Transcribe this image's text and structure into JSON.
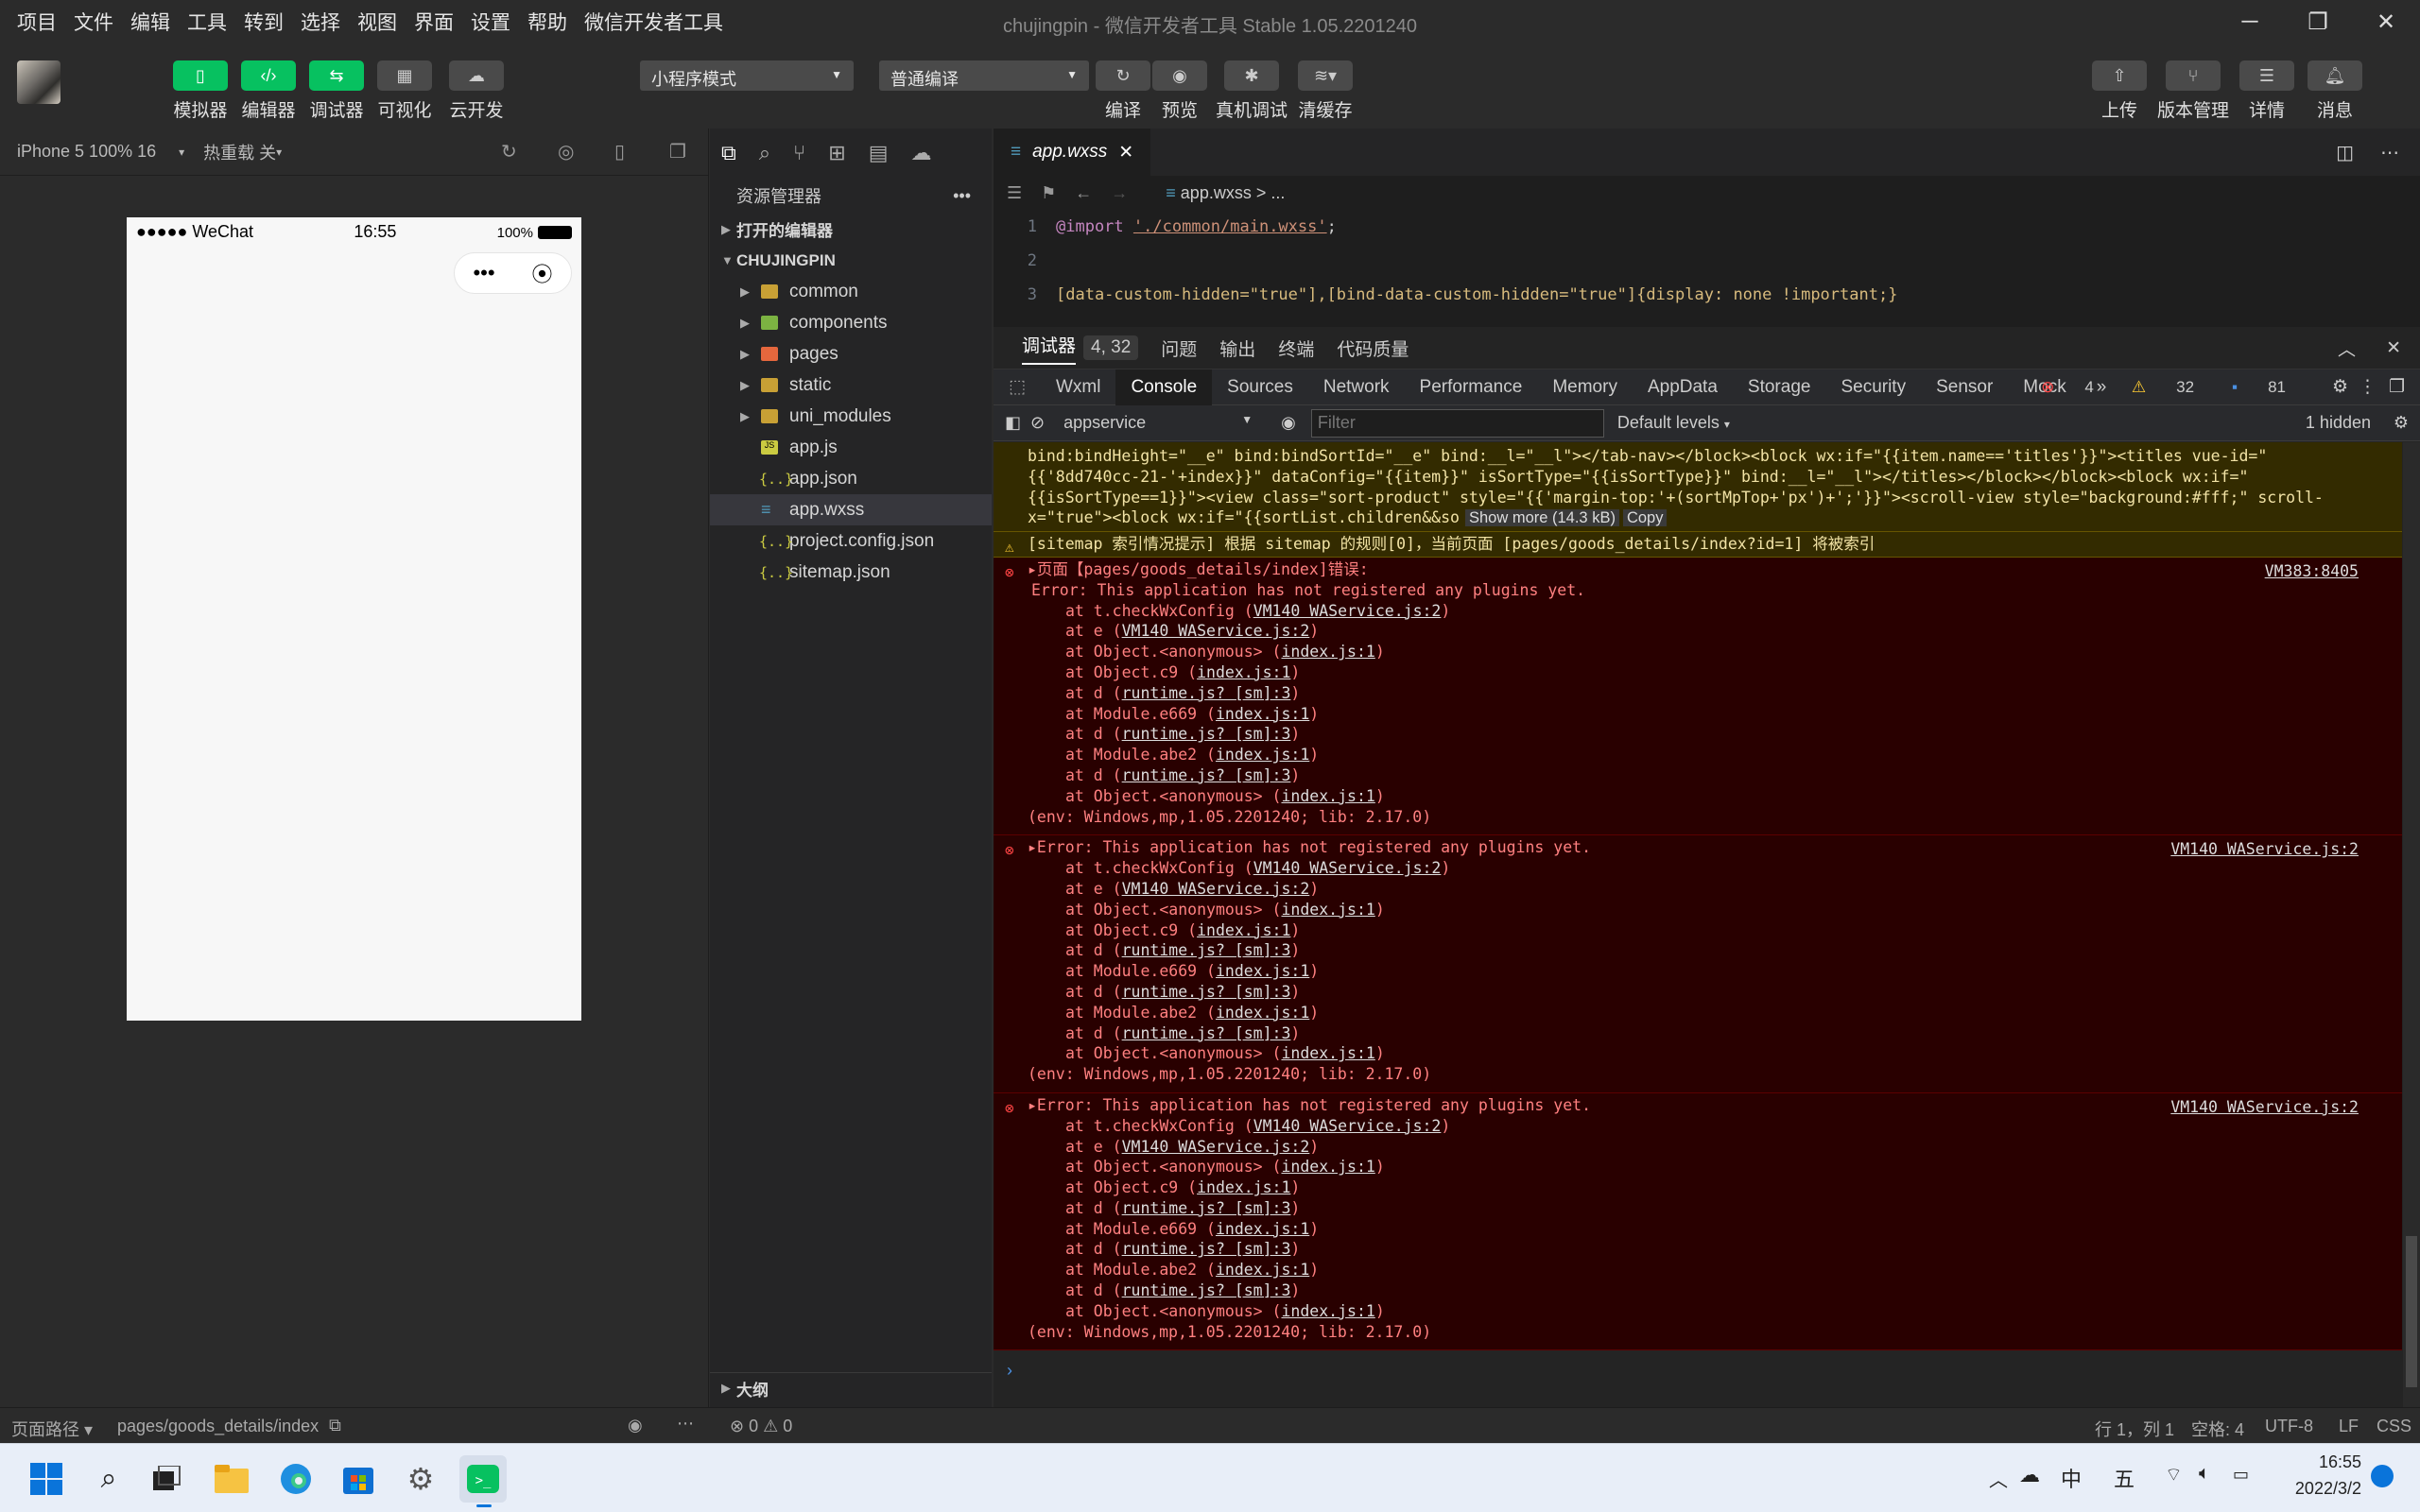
{
  "menu": [
    "项目",
    "文件",
    "编辑",
    "工具",
    "转到",
    "选择",
    "视图",
    "界面",
    "设置",
    "帮助",
    "微信开发者工具"
  ],
  "window_title": "chujingpin - 微信开发者工具 Stable 1.05.2201240",
  "toolbar": {
    "left_buttons": [
      "模拟器",
      "编辑器",
      "调试器",
      "可视化",
      "云开发"
    ],
    "mode_select": "小程序模式",
    "compile_select": "普通编译",
    "mid_buttons": [
      "编译",
      "预览",
      "真机调试",
      "清缓存"
    ],
    "right_buttons": [
      "上传",
      "版本管理",
      "详情",
      "消息"
    ]
  },
  "simulator": {
    "device": "iPhone 5 100% 16",
    "hot_reload": "热重载 关",
    "carrier": "●●●●● WeChat",
    "time": "16:55",
    "battery": "100%"
  },
  "explorer": {
    "title": "资源管理器",
    "open_editors": "打开的编辑器",
    "project": "CHUJINGPIN",
    "folders": [
      "common",
      "components",
      "pages",
      "static",
      "uni_modules"
    ],
    "files": [
      "app.js",
      "app.json",
      "app.wxss",
      "project.config.json",
      "sitemap.json"
    ],
    "outline": "大纲",
    "problems": "⊗ 0 ⚠ 0"
  },
  "editor": {
    "tab": "app.wxss",
    "breadcrumb": "app.wxss > ...",
    "lines": [
      {
        "no": "1",
        "code": "@import './common/main.wxss';"
      },
      {
        "no": "2",
        "code": ""
      },
      {
        "no": "3",
        "code": "[data-custom-hidden=\"true\"],[bind-data-custom-hidden=\"true\"]{display: none !important;}"
      }
    ]
  },
  "devtools": {
    "panel_tabs": [
      "调试器",
      "4, 32",
      "问题",
      "输出",
      "终端",
      "代码质量"
    ],
    "tabs": [
      "Wxml",
      "Console",
      "Sources",
      "Network",
      "Performance",
      "Memory",
      "AppData",
      "Storage",
      "Security",
      "Sensor",
      "Mock"
    ],
    "counts": {
      "errors": "4",
      "warnings": "32",
      "info": "81"
    },
    "context": "appservice",
    "filter_placeholder": "Filter",
    "levels": "Default levels",
    "hidden": "1 hidden"
  },
  "console": {
    "truncated_lines": [
      "bind:bindHeight=\"__e\" bind:bindSortId=\"__e\" bind:__l=\"__l\"></tab-nav></block><block wx:if=\"{{item.name=='titles'}}\"><titles vue-id=\"",
      "{{'8dd740cc-21-'+index}}\" dataConfig=\"{{item}}\" isSortType=\"{{isSortType}}\" bind:__l=\"__l\"></titles></block></block><block wx:if=\"",
      "{{isSortType==1}}\"><view class=\"sort-product\" style=\"{{'margin-top:'+(sortMpTop+'px')+';'}}\"><scroll-view style=\"background:#fff;\" scroll-",
      "x=\"true\"><block wx:if=\"{{sortList.children&&so"
    ],
    "show_more": "Show more (14.3 kB)",
    "copy": "Copy",
    "sitemap_warning": "[sitemap 索引情况提示] 根据 sitemap 的规则[0]，当前页面 [pages/goods_details/index?id=1] 将被索引",
    "errors": [
      {
        "head": "▸页面【pages/goods_details/index]错误:",
        "source": "VM383:8405",
        "first": "Error: This application has not registered any plugins yet."
      },
      {
        "head": "▸Error: This application has not registered any plugins yet.",
        "source": "VM140 WAService.js:2",
        "first": ""
      },
      {
        "head": "▸Error: This application has not registered any plugins yet.",
        "source": "VM140 WAService.js:2",
        "first": ""
      }
    ],
    "stack": [
      {
        "fn": "at t.checkWxConfig (",
        "file": "VM140 WAService.js:2",
        "end": ")"
      },
      {
        "fn": "at e (",
        "file": "VM140 WAService.js:2",
        "end": ")"
      },
      {
        "fn": "at Object.<anonymous> (",
        "file": "index.js:1",
        "end": ")"
      },
      {
        "fn": "at Object.c9 (",
        "file": "index.js:1",
        "end": ")"
      },
      {
        "fn": "at d (",
        "file": "runtime.js? [sm]:3",
        "end": ")"
      },
      {
        "fn": "at Module.e669 (",
        "file": "index.js:1",
        "end": ")"
      },
      {
        "fn": "at d (",
        "file": "runtime.js? [sm]:3",
        "end": ")"
      },
      {
        "fn": "at Module.abe2 (",
        "file": "index.js:1",
        "end": ")"
      },
      {
        "fn": "at d (",
        "file": "runtime.js? [sm]:3",
        "end": ")"
      },
      {
        "fn": "at Object.<anonymous> (",
        "file": "index.js:1",
        "end": ")"
      }
    ],
    "env": "(env: Windows,mp,1.05.2201240; lib: 2.17.0)"
  },
  "statusbar": {
    "page_path_label": "页面路径 ▾",
    "page_path": "pages/goods_details/index",
    "cursor": "行 1，列 1",
    "spaces": "空格: 4",
    "encoding": "UTF-8",
    "eol": "LF",
    "lang": "CSS"
  },
  "taskbar": {
    "ime": "中",
    "ime2": "五",
    "time": "16:55",
    "date": "2022/3/2"
  }
}
